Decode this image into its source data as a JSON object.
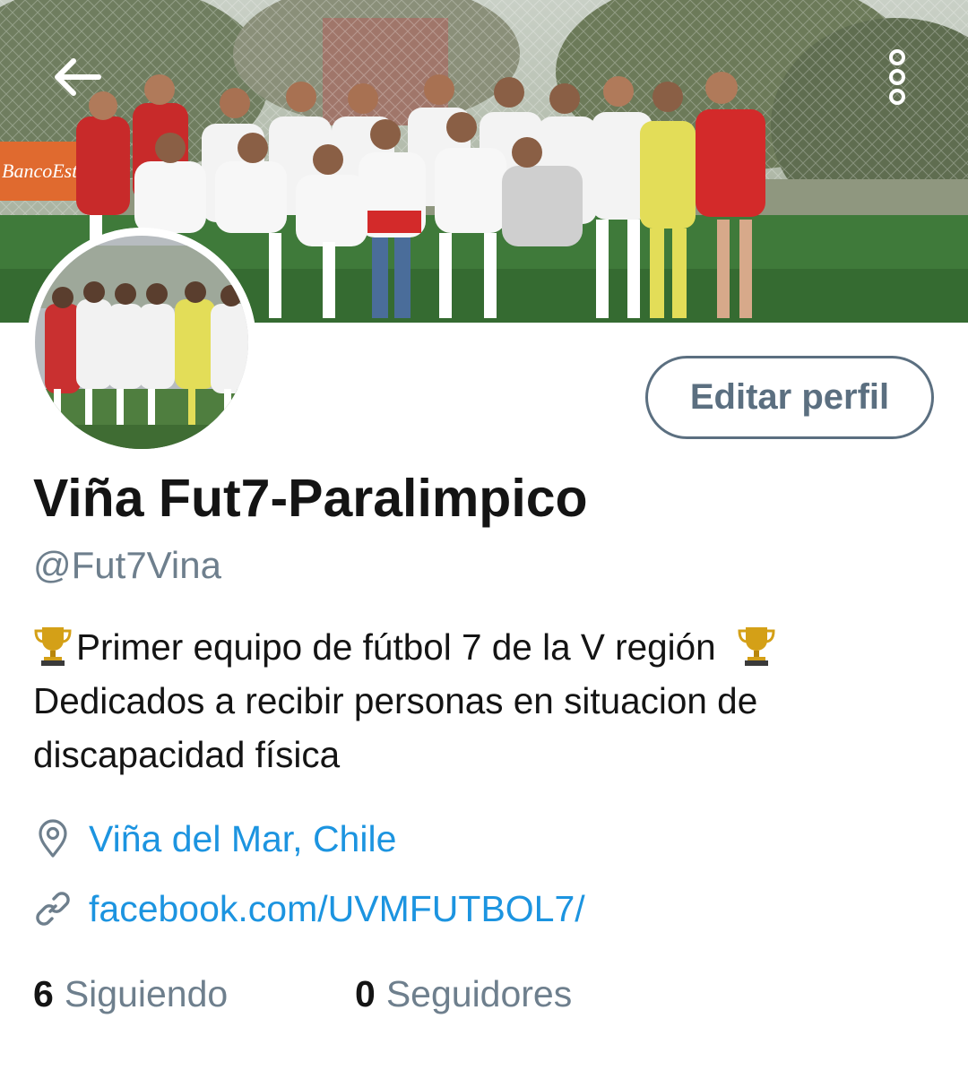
{
  "header": {
    "back_icon": "arrow-left-icon",
    "more_icon": "more-vertical-icon",
    "banner_sign_text": "BancoEstad"
  },
  "profile": {
    "display_name": "Viña Fut7-Paralimpico",
    "handle": "@Fut7Vina",
    "edit_button_label": "Editar perfil",
    "bio": {
      "line1": "Primer equipo de fútbol 7 de la V región",
      "line2": "Dedicados a recibir personas en situacion de",
      "line3": "discapacidad física",
      "emoji_icon": "trophy-icon"
    },
    "location": "Viña del Mar, Chile",
    "location_icon": "location-pin-icon",
    "website": "facebook.com/UVMFUTBOL7/",
    "website_icon": "link-icon"
  },
  "stats": {
    "following_count": "6",
    "following_label": "Siguiendo",
    "followers_count": "0",
    "followers_label": "Seguidores"
  },
  "colors": {
    "link": "#1c94e0",
    "muted": "#6e7f8d",
    "text": "#141414",
    "edit_border": "#5b6f80"
  }
}
